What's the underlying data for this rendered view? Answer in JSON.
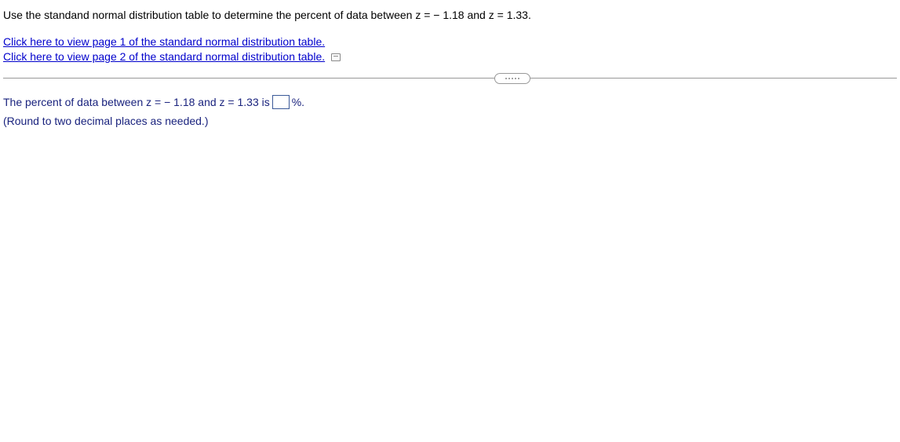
{
  "question": "Use the standand normal distribution table to determine the percent of data between z = − 1.18 and z = 1.33.",
  "links": {
    "page1": "Click here to view page 1 of the standard normal distribution table.",
    "page2": "Click here to view page 2 of the standard normal distribution table."
  },
  "answer": {
    "prefix": "The percent of data between z = − 1.18 and z = 1.33 is",
    "suffix": "%.",
    "value": ""
  },
  "hint": "(Round to two decimal places as needed.)"
}
